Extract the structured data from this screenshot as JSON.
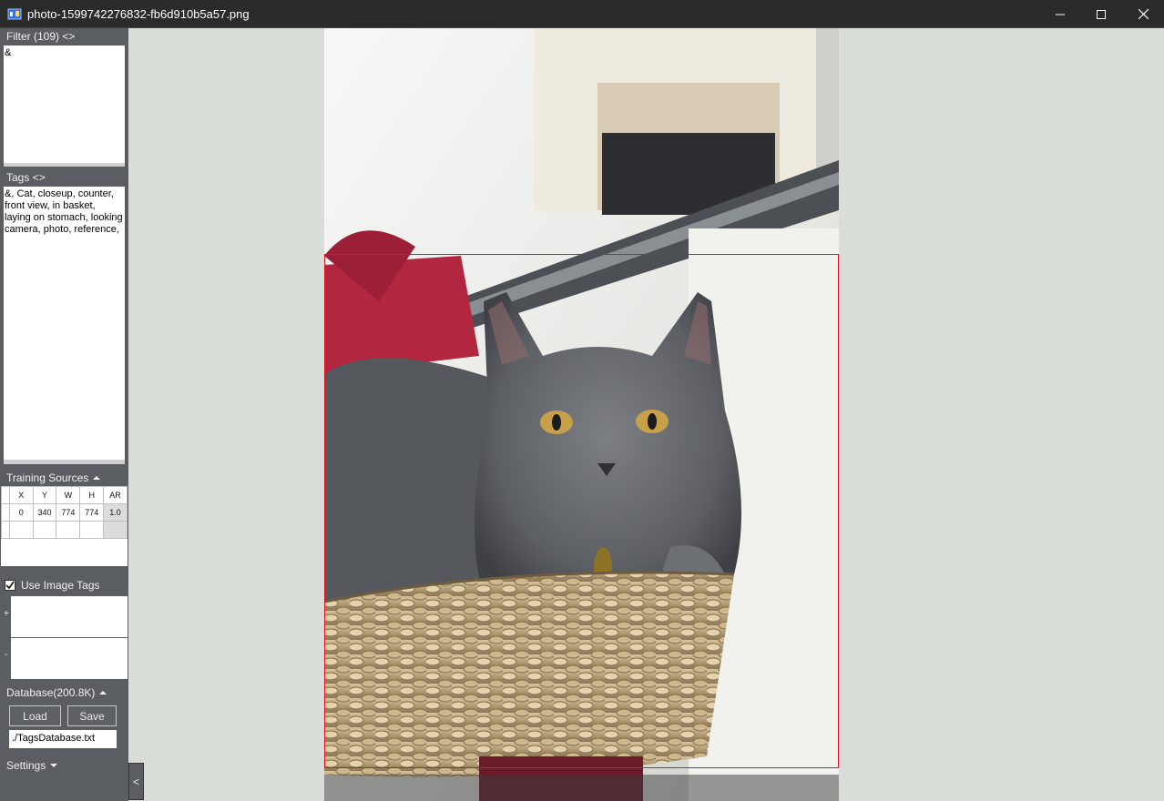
{
  "window": {
    "title": "photo-1599742276832-fb6d910b5a57.png",
    "controls": {
      "minimize_icon": "minimize-icon",
      "maximize_icon": "maximize-icon",
      "close_icon": "close-icon"
    }
  },
  "sidebar": {
    "filter": {
      "label": "Filter (109) <>",
      "value": "&"
    },
    "tags": {
      "label": "Tags <>",
      "value": "&, Cat, closeup, counter, front view, in basket, laying on stomach, looking camera, photo, reference,"
    },
    "training_sources": {
      "label": "Training Sources",
      "columns": [
        "X",
        "Y",
        "W",
        "H",
        "AR"
      ],
      "rows": [
        [
          "0",
          "340",
          "774",
          "774",
          "1.0"
        ]
      ]
    },
    "use_image_tags": {
      "label": "Use Image Tags",
      "checked": true,
      "plus": "+",
      "minus": "-"
    },
    "database": {
      "label": "Database(200.8K)",
      "load": "Load",
      "save": "Save",
      "path": "./TagsDatabase.txt"
    },
    "settings": {
      "label": "Settings"
    },
    "collapse": "<"
  },
  "colors": {
    "sidebar": "#5a5d61",
    "titlebar": "#2b2b2b",
    "viewer_bg": "#d8ded7",
    "selection": "#e0141e"
  }
}
